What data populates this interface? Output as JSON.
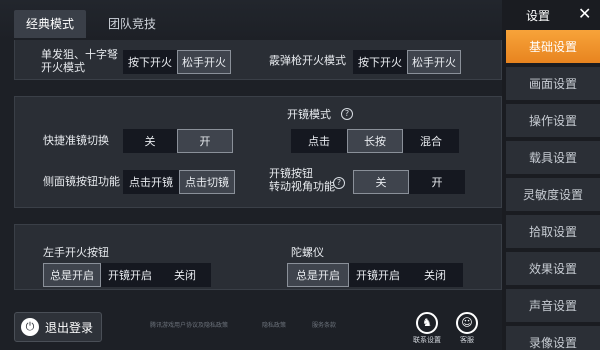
{
  "tabs": [
    {
      "label": "经典模式",
      "active": true
    },
    {
      "label": "团队竞技",
      "active": false
    }
  ],
  "fire_mode": {
    "sniper_label": "单发狙、十字弩\n开火模式",
    "sniper_options": [
      "按下开火",
      "松手开火"
    ],
    "sniper_selected": 1,
    "shotgun_label": "霰弹枪开火模式",
    "shotgun_options": [
      "按下开火",
      "松手开火"
    ],
    "shotgun_selected": 1
  },
  "scope": {
    "quick_label": "快捷准镜切换",
    "quick_options": [
      "关",
      "开"
    ],
    "quick_selected": 1,
    "side_label": "侧面镜按钮功能",
    "side_options": [
      "点击开镜",
      "点击切镜"
    ],
    "side_selected": 1,
    "open_mode_label": "开镜模式",
    "open_mode_options": [
      "点击",
      "长按",
      "混合"
    ],
    "open_mode_selected": 1,
    "rotate_label": "开镜按钮\n转动视角功能",
    "rotate_options": [
      "关",
      "开"
    ],
    "rotate_selected": 0,
    "help_glyph": "?"
  },
  "other": {
    "left_fire_label": "左手开火按钮",
    "left_fire_options": [
      "总是开启",
      "开镜开启",
      "关闭"
    ],
    "left_fire_selected": 0,
    "gyro_label": "陀螺仪",
    "gyro_options": [
      "总是开启",
      "开镜开启",
      "关闭"
    ],
    "gyro_selected": 0
  },
  "footer": {
    "logout_label": "退出登录",
    "link1": "腾讯游戏用户协议及隐私政策",
    "link2": "隐私政策",
    "link3": "服务条款",
    "link_settings_label": "联系设置",
    "service_label": "客服"
  },
  "sidebar": {
    "title": "设置",
    "close": "✕",
    "items": [
      {
        "label": "基础设置",
        "active": true
      },
      {
        "label": "画面设置",
        "active": false
      },
      {
        "label": "操作设置",
        "active": false
      },
      {
        "label": "载具设置",
        "active": false
      },
      {
        "label": "灵敏度设置",
        "active": false
      },
      {
        "label": "拾取设置",
        "active": false
      },
      {
        "label": "效果设置",
        "active": false
      },
      {
        "label": "声音设置",
        "active": false
      },
      {
        "label": "录像设置",
        "active": false
      }
    ]
  },
  "colors": {
    "accent": "#f39a2f",
    "background": "#1d2026",
    "panel": "#2a2e35"
  }
}
